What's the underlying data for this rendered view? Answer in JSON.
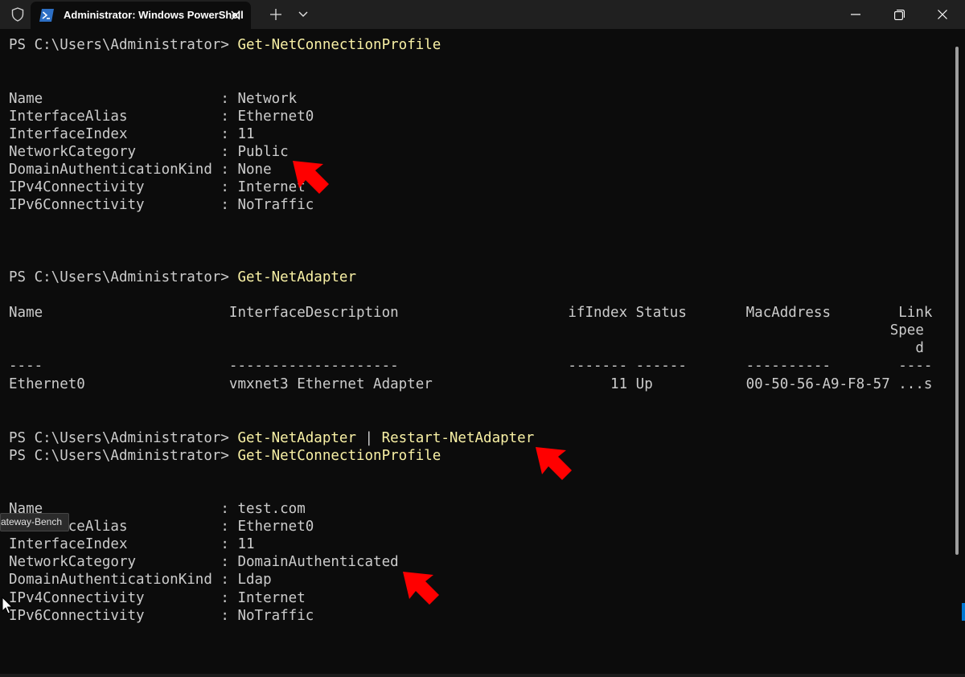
{
  "titlebar": {
    "tab_title": "Administrator: Windows PowerShell"
  },
  "icons": {
    "shield": "shield-icon",
    "powershell": "powershell-icon",
    "close": "close-icon",
    "plus": "plus-icon",
    "chevron": "chevron-down-icon",
    "minimize": "minimize-icon",
    "maximize": "restore-icon",
    "window_close": "close-icon"
  },
  "colors": {
    "background": "#0c0c0c",
    "text": "#cccccc",
    "command": "#f9f1a5",
    "annotation_arrow": "#ff0000"
  },
  "terminal": {
    "prompt": "PS C:\\Users\\Administrator> ",
    "cmd1": "Get-NetConnectionProfile",
    "profile1": [
      "Name                     : Network",
      "InterfaceAlias           : Ethernet0",
      "InterfaceIndex           : 11",
      "NetworkCategory          : Public",
      "DomainAuthenticationKind : None",
      "IPv4Connectivity         : Internet",
      "IPv6Connectivity         : NoTraffic"
    ],
    "cmd2": "Get-NetAdapter",
    "adapter_table": [
      "Name                      InterfaceDescription                    ifIndex Status       MacAddress        Link",
      "                                                                                                        Spee",
      "                                                                                                           d",
      "----                      --------------------                    ------- ------       ----------        ----",
      "Ethernet0                 vmxnet3 Ethernet Adapter                     11 Up           00-50-56-A9-F8-57 ...s"
    ],
    "cmd3a": "Get-NetAdapter",
    "cmd3_pipe": " | ",
    "cmd3b": "Restart-NetAdapter",
    "cmd4": "Get-NetConnectionProfile",
    "profile2": [
      "Name                     : test.com",
      "InterfaceAlias           : Ethernet0",
      "InterfaceIndex           : 11",
      "NetworkCategory          : DomainAuthenticated",
      "DomainAuthenticationKind : Ldap",
      "IPv4Connectivity         : Internet",
      "IPv6Connectivity         : NoTraffic"
    ]
  },
  "tooltip": {
    "text": "Gateway-Bench"
  }
}
